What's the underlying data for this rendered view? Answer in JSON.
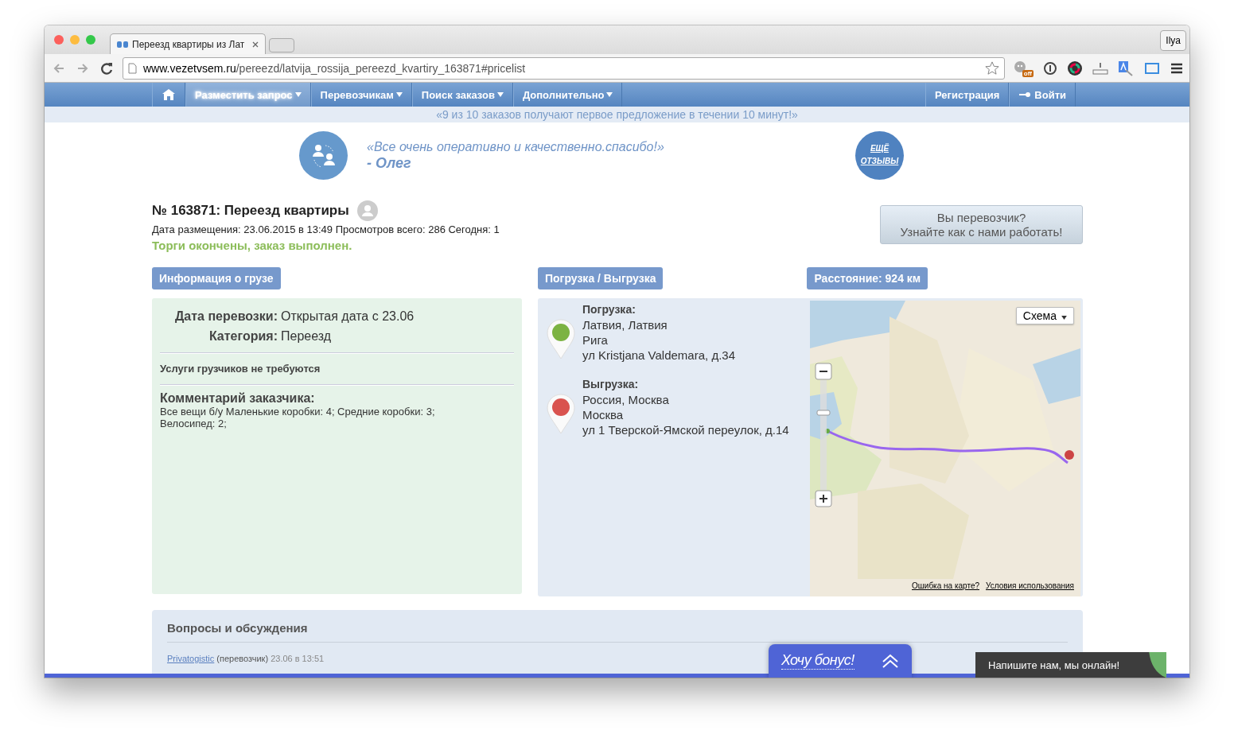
{
  "browser": {
    "tab": {
      "title": "Переезд квартиры из Лат"
    },
    "url": {
      "domain": "www.vezetvsem.ru",
      "path": "/pereezd/latvija_rossija_pereezd_kvartiry_163871#pricelist"
    },
    "profile": "Ilya",
    "extension_badge": "off"
  },
  "nav": {
    "left": [
      {
        "label": "Разместить запрос",
        "selected": true
      },
      {
        "label": "Перевозчикам",
        "selected": false
      },
      {
        "label": "Поиск заказов",
        "selected": false
      },
      {
        "label": "Дополнительно",
        "selected": false
      }
    ],
    "right": [
      {
        "label": "Регистрация",
        "kind": "text"
      },
      {
        "label": "Войти",
        "kind": "key"
      }
    ]
  },
  "banner": "«9 из 10 заказов получают первое предложение в течении 10 минут!»",
  "testimonial": {
    "quote": "«Все очень оперативно и качественно.спасибо!»",
    "author": "- Олег",
    "more_link": [
      "ЕЩЁ",
      "ОТЗЫВЫ"
    ]
  },
  "order": {
    "title": "№ 163871: Переезд квартиры",
    "meta": "Дата размещения: 23.06.2015 в 13:49 Просмотров всего: 286 Сегодня: 1",
    "status": "Торги окончены, заказ выполнен.",
    "carrier_button": [
      "Вы перевозчик?",
      "Узнайте как с нами работать!"
    ]
  },
  "cargo": {
    "header": "Информация о грузе",
    "fields": [
      {
        "label": "Дата перевозки:",
        "value": "Открытая дата с 23.06"
      },
      {
        "label": "Категория:",
        "value": "Переезд"
      }
    ],
    "movers": "Услуги грузчиков не требуются",
    "comment_title": "Комментарий заказчика:",
    "comment": "Все вещи б/у Маленькие коробки: 4; Средние коробки: 3; Велосипед: 2;"
  },
  "route": {
    "header": "Погрузка / Выгрузка",
    "points": [
      {
        "title": "Погрузка:",
        "color": "#7cb342",
        "lines": [
          "Латвия, Латвия",
          "Рига",
          "ул Kristjana Valdemara, д.34"
        ]
      },
      {
        "title": "Выгрузка:",
        "color": "#d9534f",
        "lines": [
          "Россия, Москва",
          "Москва",
          "ул 1 Тверской-Ямской переулок, д.14"
        ]
      }
    ]
  },
  "map": {
    "header": "Расстояние: 924 км",
    "kind": "picture",
    "layer_button": "Схема",
    "links": [
      "Ошибка на карте?",
      "Условия использования"
    ]
  },
  "discussion": {
    "title": "Вопросы и обсуждения",
    "comment": {
      "author": "Privatogistic",
      "role": "(перевозчик)",
      "date": "23.06 в 13:51"
    }
  },
  "bonus": "Хочу бонус!",
  "chat": "Напишите нам, мы онлайн!"
}
